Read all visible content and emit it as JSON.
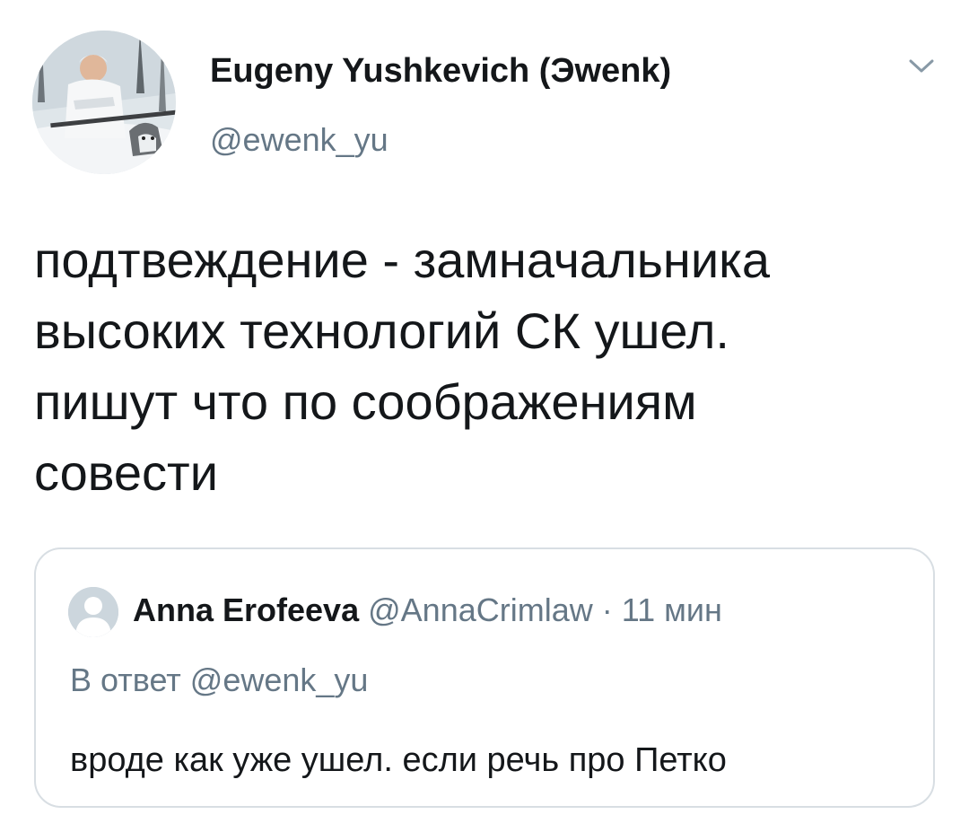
{
  "tweet": {
    "author": {
      "display_name": "Eugeny Yushkevich (Эwenk)",
      "handle": "@ewenk_yu",
      "avatar_icon": "profile-photo"
    },
    "menu_icon": "chevron-down-icon",
    "text": "подтвеждение - замначальника\nвысоких технологий СК ушел.\nпишут что по соображениям\nсовести"
  },
  "quoted_tweet": {
    "author": {
      "display_name": "Anna Erofeeva",
      "handle": "@AnnaCrimlaw",
      "avatar_icon": "default-avatar-icon"
    },
    "separator": "·",
    "time": "11 мин",
    "reply_to": "В ответ @ewenk_yu",
    "text": "вроде как уже ушел. если речь про Петко"
  },
  "colors": {
    "text_primary": "#14171a",
    "text_secondary": "#657786",
    "border": "#d8dee3"
  }
}
